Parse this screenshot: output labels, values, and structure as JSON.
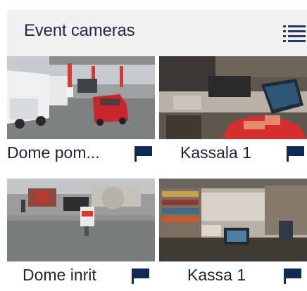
{
  "widget": {
    "title": "Event cameras",
    "icons": {
      "view_toggle": "list-view-icon"
    },
    "accent_color": "#0f2a55"
  },
  "cameras": [
    {
      "label": "Dome pom...",
      "icon": "flag-icon"
    },
    {
      "label": "Kassala 1",
      "icon": "flag-icon"
    },
    {
      "label": "Dome inrit",
      "icon": "flag-icon"
    },
    {
      "label": "Kassa 1",
      "icon": "flag-icon"
    }
  ]
}
